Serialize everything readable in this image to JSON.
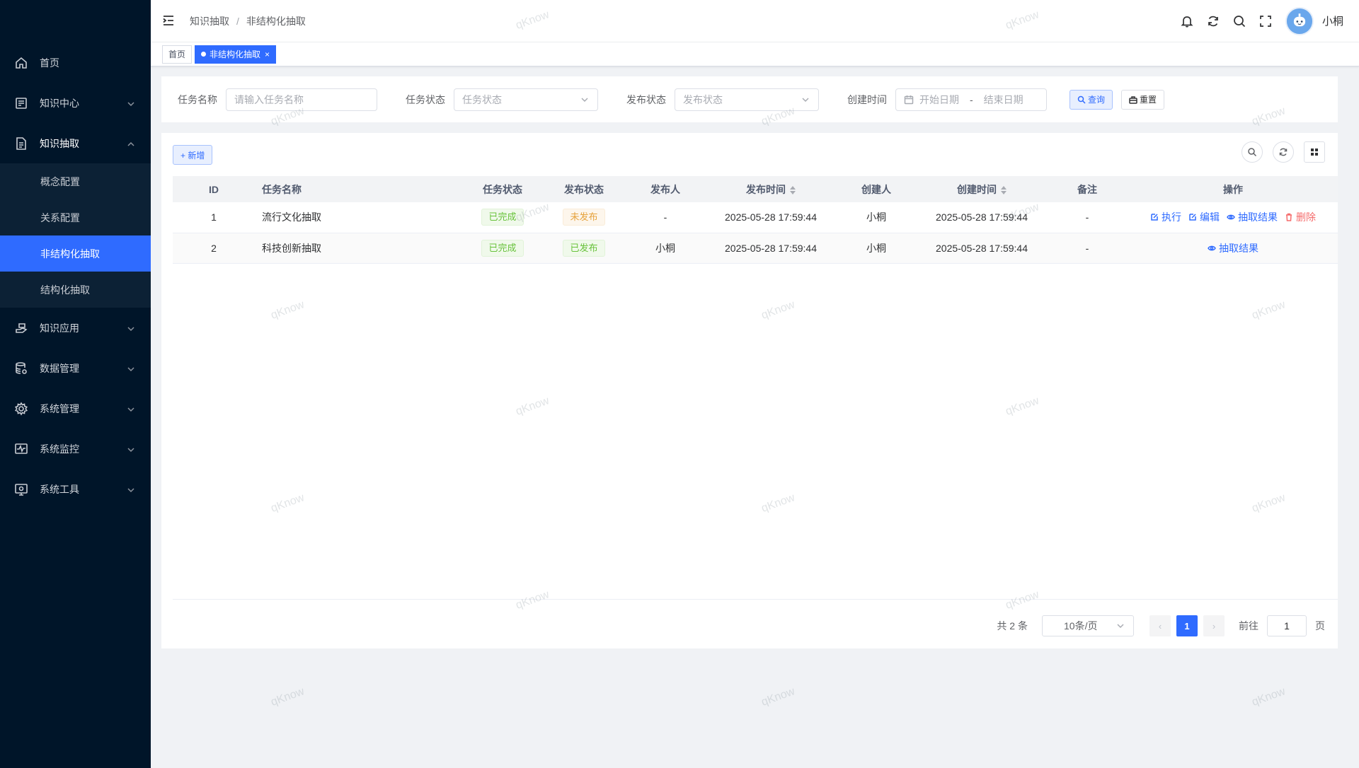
{
  "sidebar": {
    "items": [
      {
        "label": "首页",
        "icon": "home-icon"
      },
      {
        "label": "知识中心",
        "icon": "book-icon"
      },
      {
        "label": "知识抽取",
        "icon": "document-icon",
        "open": true,
        "children": [
          {
            "label": "概念配置"
          },
          {
            "label": "关系配置"
          },
          {
            "label": "非结构化抽取",
            "active": true
          },
          {
            "label": "结构化抽取"
          }
        ]
      },
      {
        "label": "知识应用",
        "icon": "hand-icon"
      },
      {
        "label": "数据管理",
        "icon": "database-icon"
      },
      {
        "label": "系统管理",
        "icon": "gear-icon"
      },
      {
        "label": "系统监控",
        "icon": "monitor-icon"
      },
      {
        "label": "系统工具",
        "icon": "tool-icon"
      }
    ]
  },
  "header": {
    "breadcrumb": [
      "知识抽取",
      "非结构化抽取"
    ],
    "breadcrumb_sep": "/",
    "username": "小桐"
  },
  "tags": {
    "items": [
      {
        "label": "首页"
      },
      {
        "label": "非结构化抽取",
        "active": true
      }
    ],
    "close_glyph": "×"
  },
  "search": {
    "task_name_label": "任务名称",
    "task_name_placeholder": "请输入任务名称",
    "task_status_label": "任务状态",
    "task_status_placeholder": "任务状态",
    "publish_status_label": "发布状态",
    "publish_status_placeholder": "发布状态",
    "create_time_label": "创建时间",
    "start_date_placeholder": "开始日期",
    "range_sep": "-",
    "end_date_placeholder": "结束日期",
    "query_label": "查询",
    "reset_label": "重置"
  },
  "toolbar": {
    "add_label": "+ 新增"
  },
  "table": {
    "columns": [
      "ID",
      "任务名称",
      "任务状态",
      "发布状态",
      "发布人",
      "发布时间",
      "创建人",
      "创建时间",
      "备注",
      "操作"
    ],
    "rows": [
      {
        "id": "1",
        "name": "流行文化抽取",
        "task_status": "已完成",
        "publish_status": "未发布",
        "publisher": "-",
        "publish_time": "2025-05-28 17:59:44",
        "creator": "小桐",
        "create_time": "2025-05-28 17:59:44",
        "remark": "-",
        "actions": [
          "执行",
          "编辑",
          "抽取结果",
          "删除"
        ]
      },
      {
        "id": "2",
        "name": "科技创新抽取",
        "task_status": "已完成",
        "publish_status": "已发布",
        "publisher": "小桐",
        "publish_time": "2025-05-28 17:59:44",
        "creator": "小桐",
        "create_time": "2025-05-28 17:59:44",
        "remark": "-",
        "actions": [
          "抽取结果"
        ]
      }
    ]
  },
  "pagination": {
    "total_text": "共 2 条",
    "page_size": "10条/页",
    "current_page": "1",
    "goto_label": "前往",
    "goto_value": "1",
    "page_suffix": "页",
    "prev_glyph": "‹",
    "next_glyph": "›"
  },
  "watermark": "qKnow",
  "colors": {
    "sidebar_bg": "#001529",
    "accent": "#2f6bff",
    "success": "#67c23a",
    "warning": "#e6a23c",
    "danger": "#f56c6c"
  }
}
